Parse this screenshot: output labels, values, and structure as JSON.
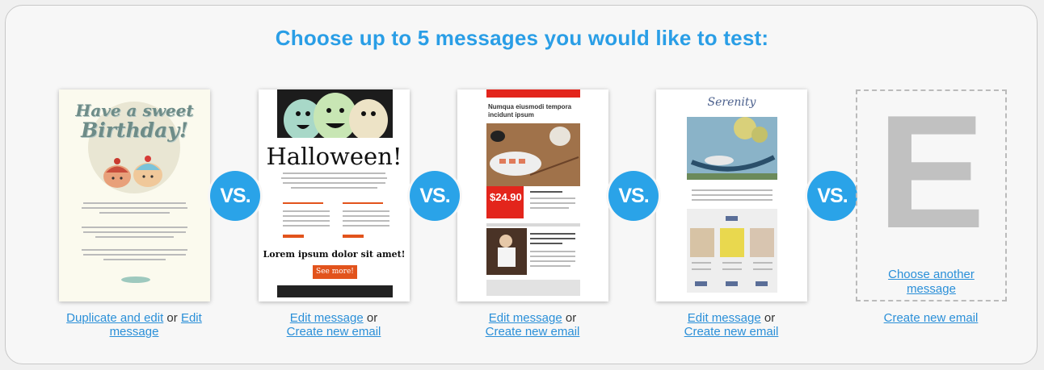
{
  "heading": "Choose up to 5 messages you would like to test:",
  "vs_label": "VS.",
  "cards": [
    {
      "name": "birthday",
      "thumb_title_line1": "Have a sweet",
      "thumb_title_line2": "Birthday!",
      "link_primary": "Duplicate and edit",
      "separator": " or ",
      "link_secondary_1": "Edit",
      "link_secondary_2": "message"
    },
    {
      "name": "halloween",
      "thumb_title": "Halloween!",
      "thumb_heading": "Lorem ipsum dolor sit amet!",
      "thumb_button": "See more!",
      "link_primary": "Edit message",
      "separator": " or ",
      "link_secondary": "Create new email"
    },
    {
      "name": "food",
      "thumb_title": "Numqua eiusmodi tempora incidunt ipsum",
      "thumb_price": "$24.90",
      "link_primary": "Edit message",
      "separator": " or ",
      "link_secondary": "Create new email"
    },
    {
      "name": "serenity",
      "thumb_title": "Serenity",
      "link_primary": "Edit message",
      "separator": " or ",
      "link_secondary": "Create new email"
    }
  ],
  "placeholder": {
    "letter": "E",
    "link_line1": "Choose another",
    "link_line2": "message",
    "create_link": "Create new email"
  },
  "colors": {
    "accent": "#2aa3e8",
    "link": "#2a8fd8",
    "red": "#e3251c",
    "orange": "#e2531c"
  }
}
